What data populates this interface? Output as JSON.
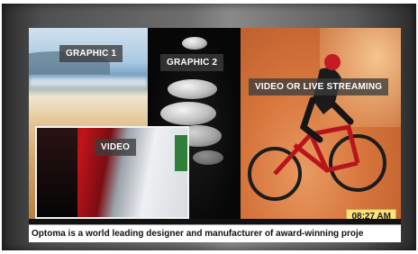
{
  "zones": {
    "graphic1_label": "GRAPHIC 1",
    "graphic2_label": "GRAPHIC 2",
    "stream_label": "VIDEO OR LIVE STREAMING",
    "video_label": "VIDEO"
  },
  "clock": "08:27 AM",
  "ticker": "Optoma is a world leading designer and manufacturer of award-winning proje",
  "colors": {
    "label_bg": "#3c3c3c",
    "clock_bg": "#fde27a",
    "ticker_bg": "#ffffff"
  }
}
